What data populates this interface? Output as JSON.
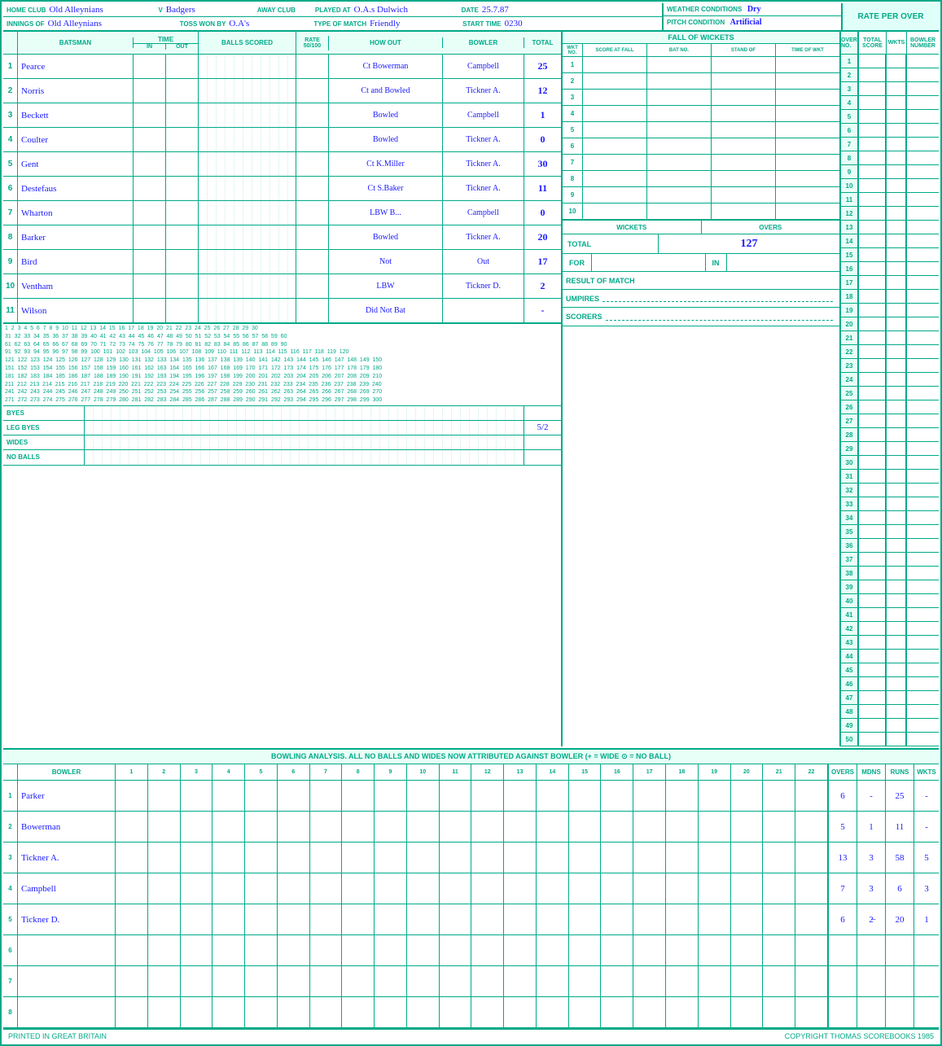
{
  "header": {
    "home_club_label": "HOME CLUB",
    "home_club": "Old Alleynians",
    "vs": "v",
    "away_club_label": "AWAY CLUB",
    "away_club": "Badgers",
    "played_at_label": "PLAYED AT",
    "played_at": "O.A.s Dulwich",
    "date_label": "DATE",
    "date": "25.7.87",
    "weather_label": "WEATHER CONDITIONS",
    "weather": "Dry",
    "rate_per_over_label": "RATE PER OVER",
    "innings_label": "INNINGS OF",
    "innings_of": "Old Alleynians",
    "toss_won_label": "TOSS WON BY",
    "toss_won": "O.A's",
    "type_of_match_label": "TYPE OF MATCH",
    "type_of_match": "Friendly",
    "start_time_label": "START TIME",
    "start_time": "0230",
    "pitch_condition_label": "PITCH CONDITION",
    "pitch_condition": "Artificial"
  },
  "col_headers": {
    "batsman": "BATSMAN",
    "time_in": "IN",
    "time_out": "OUT",
    "rate": "RATE 50/100",
    "how_out": "HOW OUT",
    "bowler": "BOWLER",
    "total": "TOTAL"
  },
  "batsmen": [
    {
      "num": "1",
      "name": "Pearce",
      "how_out": "Ct Bowerman",
      "bowler": "Campbell",
      "total": "25"
    },
    {
      "num": "2",
      "name": "Norris",
      "how_out": "Ct and Bowled",
      "bowler": "Tickner A.",
      "total": "12"
    },
    {
      "num": "3",
      "name": "Beckett",
      "how_out": "Bowled",
      "bowler": "Campbell",
      "total": "1"
    },
    {
      "num": "4",
      "name": "Coulter",
      "how_out": "Bowled",
      "bowler": "Tickner A.",
      "total": "0"
    },
    {
      "num": "5",
      "name": "Gent",
      "how_out": "Ct K.Miller",
      "bowler": "Tickner A.",
      "total": "30"
    },
    {
      "num": "6",
      "name": "Destefaus",
      "how_out": "Ct S.Baker",
      "bowler": "Tickner A.",
      "total": "11"
    },
    {
      "num": "7",
      "name": "Wharton",
      "how_out": "LBW B...",
      "bowler": "Campbell",
      "total": "0"
    },
    {
      "num": "8",
      "name": "Barker",
      "how_out": "Bowled",
      "bowler": "Tickner A.",
      "total": "20"
    },
    {
      "num": "9",
      "name": "Bird",
      "how_out": "Not",
      "bowler": "Out",
      "total": "17"
    },
    {
      "num": "10",
      "name": "Ventham",
      "how_out": "LBW",
      "bowler": "Tickner D.",
      "total": "2"
    },
    {
      "num": "11",
      "name": "Wilson",
      "how_out": "Did Not Bat",
      "bowler": "",
      "total": "-"
    }
  ],
  "fall_of_wickets": {
    "title": "FALL OF WICKETS",
    "headers": [
      "WKT NO.",
      "SCORE AT FALL",
      "BAT NO.",
      "STAND OF",
      "TIME OF WKT"
    ],
    "rows": [
      {
        "wkt": "1",
        "score": "",
        "bat": "",
        "stand": "",
        "time": ""
      },
      {
        "wkt": "2",
        "score": "",
        "bat": "",
        "stand": "",
        "time": ""
      },
      {
        "wkt": "3",
        "score": "",
        "bat": "",
        "stand": "",
        "time": ""
      },
      {
        "wkt": "4",
        "score": "",
        "bat": "",
        "stand": "",
        "time": ""
      },
      {
        "wkt": "5",
        "score": "",
        "bat": "",
        "stand": "",
        "time": ""
      },
      {
        "wkt": "6",
        "score": "",
        "bat": "",
        "stand": "",
        "time": ""
      },
      {
        "wkt": "7",
        "score": "",
        "bat": "",
        "stand": "",
        "time": ""
      },
      {
        "wkt": "8",
        "score": "",
        "bat": "",
        "stand": "",
        "time": ""
      },
      {
        "wkt": "9",
        "score": "",
        "bat": "",
        "stand": "",
        "time": ""
      },
      {
        "wkt": "10",
        "score": "",
        "bat": "",
        "stand": "",
        "time": ""
      }
    ]
  },
  "extras": {
    "byes_label": "BYES",
    "leg_byes_label": "LEG BYES",
    "leg_byes_total": "5/2",
    "wides_label": "WIDES",
    "no_balls_label": "NO BALLS",
    "total_label": "TOTAL",
    "total_value": "127"
  },
  "wickets_overs": {
    "wickets_label": "WICKETS",
    "overs_label": "OVERS",
    "for_label": "FOR",
    "in_label": "IN",
    "result_label": "RESULT OF MATCH",
    "umpires_label": "UMPIRES",
    "scorers_label": "SCORERS"
  },
  "bowling": {
    "title": "BOWLING ANALYSIS.    ALL NO BALLS AND WIDES NOW ATTRIBUTED AGAINST BOWLER (+ = WIDE  ⊙ = NO BALL)",
    "col_headers": {
      "bowler": "BOWLER",
      "overs": [
        "1",
        "2",
        "3",
        "4",
        "5",
        "6",
        "7",
        "8",
        "9",
        "10",
        "11",
        "12",
        "13",
        "14",
        "15",
        "16",
        "17",
        "18",
        "19",
        "20",
        "21",
        "22"
      ],
      "overs_h": "OVERS",
      "mdns_h": "MDNS",
      "runs_h": "RUNS",
      "wkts_h": "WKTS"
    },
    "bowlers": [
      {
        "num": "1",
        "name": "Parker",
        "overs": "6",
        "mdns": "-",
        "runs": "25",
        "wkts": "-"
      },
      {
        "num": "2",
        "name": "Bowerman",
        "overs": "5",
        "mdns": "1",
        "runs": "11",
        "wkts": "-"
      },
      {
        "num": "3",
        "name": "Tickner A.",
        "overs": "13",
        "mdns": "3",
        "runs": "58",
        "wkts": "5"
      },
      {
        "num": "4",
        "name": "Campbell",
        "overs": "7",
        "mdns": "3",
        "runs": "6",
        "wkts": "3"
      },
      {
        "num": "5",
        "name": "Tickner D.",
        "overs": "6",
        "mdns": "2̶",
        "runs": "20",
        "wkts": "1"
      },
      {
        "num": "6",
        "name": "",
        "overs": "",
        "mdns": "",
        "runs": "",
        "wkts": ""
      },
      {
        "num": "7",
        "name": "",
        "overs": "",
        "mdns": "",
        "runs": "",
        "wkts": ""
      },
      {
        "num": "8",
        "name": "",
        "overs": "",
        "mdns": "",
        "runs": "",
        "wkts": ""
      }
    ]
  },
  "right_numbers": [
    1,
    2,
    3,
    4,
    5,
    6,
    7,
    8,
    9,
    10,
    11,
    12,
    13,
    14,
    15,
    16,
    17,
    18,
    19,
    20,
    21,
    22,
    23,
    24,
    25,
    26,
    27,
    28,
    29,
    30,
    31,
    32,
    33,
    34,
    35,
    36,
    37,
    38,
    39,
    40,
    41,
    42,
    43,
    44,
    45,
    46,
    47,
    48,
    49,
    50
  ],
  "footer": {
    "left": "PRINTED IN GREAT BRITAIN",
    "right": "COPYRIGHT THOMAS SCOREBOOKS 1985"
  }
}
